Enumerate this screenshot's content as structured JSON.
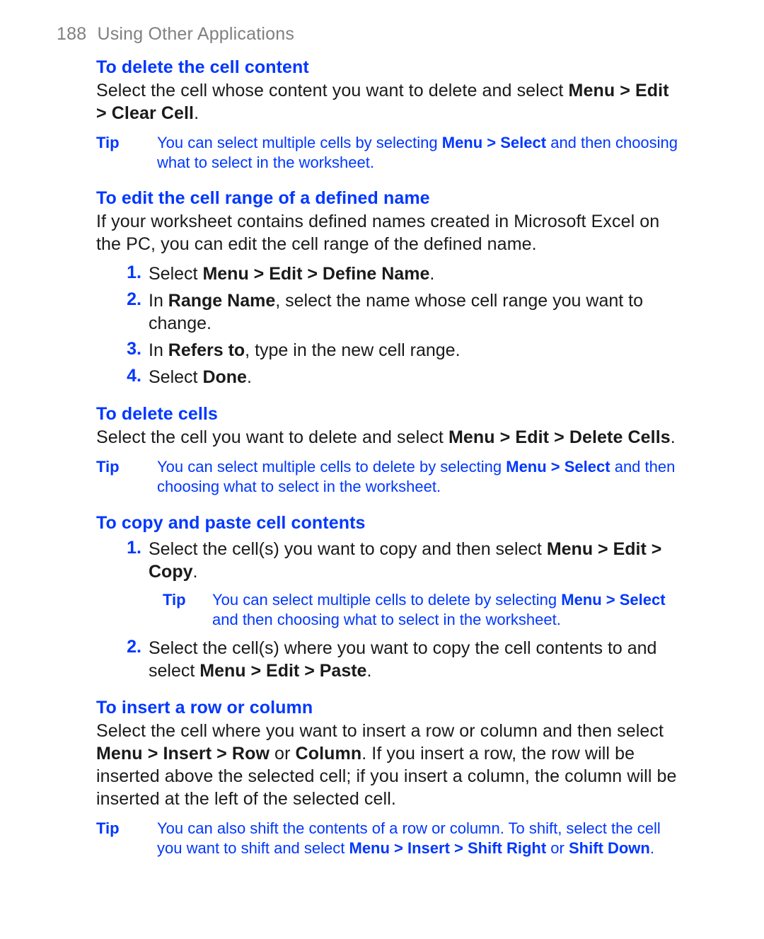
{
  "header": {
    "page_number": "188",
    "section": "Using Other Applications"
  },
  "sec_delete_content": {
    "title": "To delete the cell content",
    "para": [
      "Select the cell whose content you want to delete and select ",
      {
        "b": "Menu > Edit > Clear Cell"
      },
      "."
    ],
    "tip_label": "Tip",
    "tip": [
      "You can select multiple cells by selecting ",
      {
        "b": "Menu > Select"
      },
      " and then choosing what to select in the worksheet."
    ]
  },
  "sec_edit_range": {
    "title": "To edit the cell range of a defined name",
    "para": [
      "If your worksheet contains defined names created in Microsoft Excel on the PC, you can edit the cell range of the defined name."
    ],
    "steps": [
      [
        "Select ",
        {
          "b": "Menu > Edit > Define Name"
        },
        "."
      ],
      [
        "In ",
        {
          "b": "Range Name"
        },
        ", select the name whose cell range you want to change."
      ],
      [
        "In ",
        {
          "b": "Refers to"
        },
        ", type in the new cell range."
      ],
      [
        "Select ",
        {
          "b": "Done"
        },
        "."
      ]
    ]
  },
  "sec_delete_cells": {
    "title": "To delete cells",
    "para": [
      "Select the cell you want to delete and select ",
      {
        "b": "Menu > Edit > Delete Cells"
      },
      "."
    ],
    "tip_label": "Tip",
    "tip": [
      "You can select multiple cells to delete by selecting ",
      {
        "b": "Menu > Select"
      },
      " and then choosing what to select in the worksheet."
    ]
  },
  "sec_copy_paste": {
    "title": "To copy and paste cell contents",
    "steps": [
      [
        "Select the cell(s) you want to copy and then select ",
        {
          "b": "Menu > Edit > Copy"
        },
        "."
      ],
      [
        "Select the cell(s) where you want to copy the cell contents to and select ",
        {
          "b": "Menu > Edit > Paste"
        },
        "."
      ]
    ],
    "nested_tip_after_step": 1,
    "nested_tip_label": "Tip",
    "nested_tip": [
      "You can select multiple cells to delete by selecting ",
      {
        "b": "Menu > Select"
      },
      " and then choosing what to select in the worksheet."
    ]
  },
  "sec_insert_rc": {
    "title": "To insert a row or column",
    "para": [
      "Select the cell where you want to insert a row or column and then select ",
      {
        "b": "Menu > Insert > Row"
      },
      " or ",
      {
        "b": "Column"
      },
      ". If you insert a row, the row will be inserted above the selected cell; if you insert a column, the column will be inserted at the left of the selected cell."
    ],
    "tip_label": "Tip",
    "tip": [
      "You can also shift the contents of a row or column. To shift, select the cell you want to shift and select ",
      {
        "b": "Menu > Insert > Shift Right"
      },
      " or ",
      {
        "b": "Shift Down"
      },
      "."
    ]
  }
}
